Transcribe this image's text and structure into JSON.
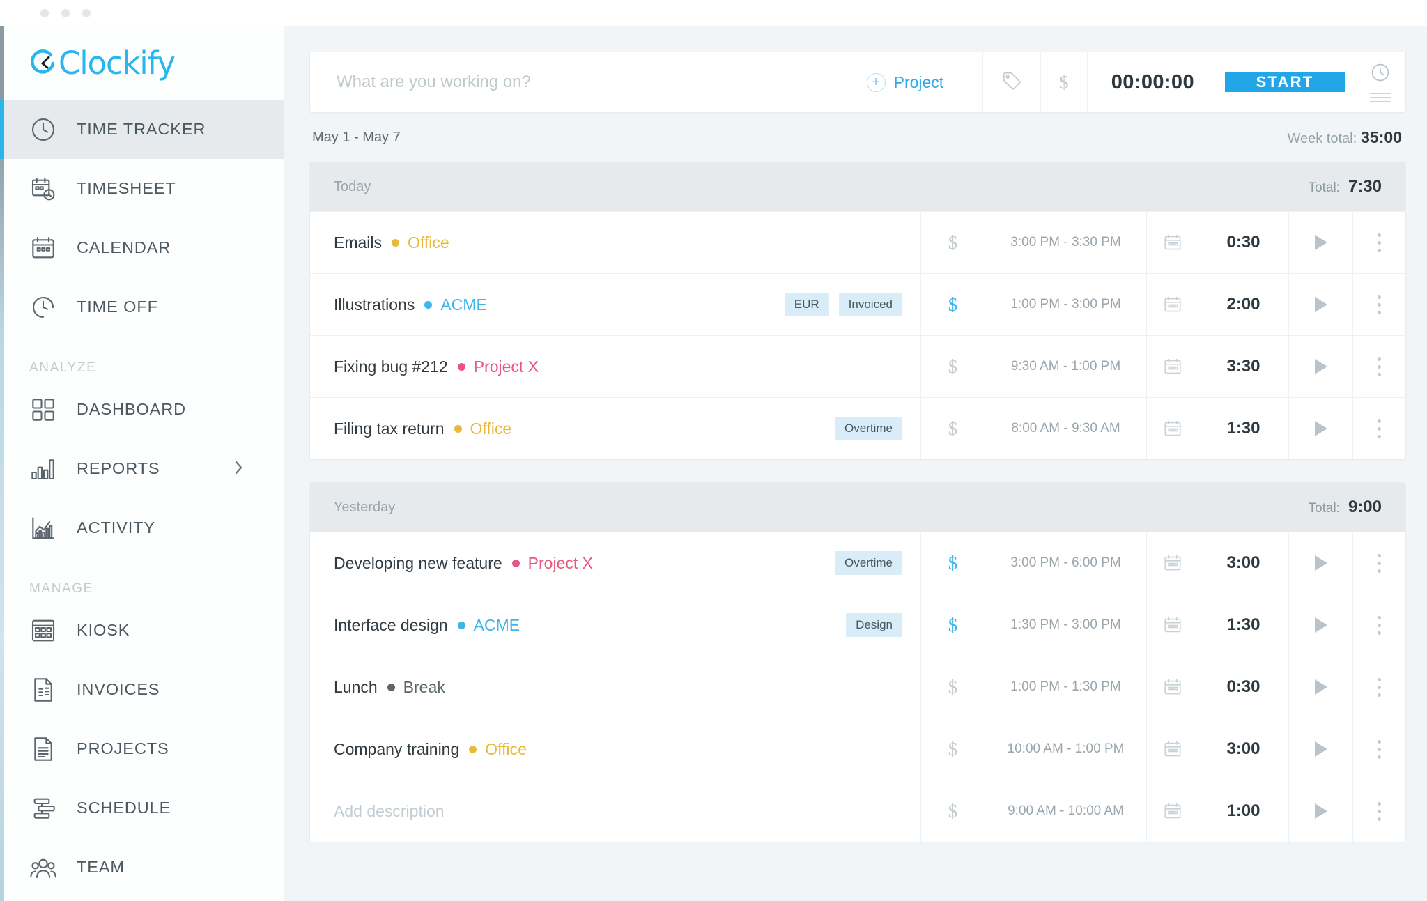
{
  "window": {
    "dots": 3
  },
  "brand": {
    "name": "Clockify",
    "color": "#28b6ef"
  },
  "sidebar": {
    "items": [
      {
        "label": "TIME TRACKER",
        "icon": "clock-icon",
        "active": true,
        "section": null,
        "chevron": false
      },
      {
        "label": "TIMESHEET",
        "icon": "timesheet-icon",
        "active": false,
        "section": null,
        "chevron": false
      },
      {
        "label": "CALENDAR",
        "icon": "calendar-icon",
        "active": false,
        "section": null,
        "chevron": false
      },
      {
        "label": "TIME OFF",
        "icon": "time-off-icon",
        "active": false,
        "section": null,
        "chevron": false
      },
      {
        "label": "DASHBOARD",
        "icon": "dashboard-icon",
        "active": false,
        "section": "ANALYZE",
        "chevron": false
      },
      {
        "label": "REPORTS",
        "icon": "reports-icon",
        "active": false,
        "section": null,
        "chevron": true
      },
      {
        "label": "ACTIVITY",
        "icon": "activity-icon",
        "active": false,
        "section": null,
        "chevron": false
      },
      {
        "label": "KIOSK",
        "icon": "kiosk-icon",
        "active": false,
        "section": "MANAGE",
        "chevron": false
      },
      {
        "label": "INVOICES",
        "icon": "invoices-icon",
        "active": false,
        "section": null,
        "chevron": false
      },
      {
        "label": "PROJECTS",
        "icon": "projects-icon",
        "active": false,
        "section": null,
        "chevron": false
      },
      {
        "label": "SCHEDULE",
        "icon": "schedule-icon",
        "active": false,
        "section": null,
        "chevron": false
      },
      {
        "label": "TEAM",
        "icon": "team-icon",
        "active": false,
        "section": null,
        "chevron": false
      }
    ],
    "sections": [
      "ANALYZE",
      "MANAGE"
    ]
  },
  "timer": {
    "placeholder": "What are you working on?",
    "value": "",
    "project_label": "Project",
    "tag_icon": "tag-icon",
    "billable_icon": "dollar-icon",
    "duration": "00:00:00",
    "start_label": "START",
    "mode_icon": "clock-mode-icon",
    "list_icon": "list-mode-icon",
    "accent": "#21a7e8"
  },
  "week": {
    "range": "May 1 - May 7",
    "total_label": "Week total:",
    "total_value": "35:00"
  },
  "days": [
    {
      "name": "Today",
      "total_label": "Total:",
      "total_value": "7:30",
      "entries": [
        {
          "description": "Emails",
          "is_placeholder": false,
          "project": "Office",
          "project_color": "#e9b93c",
          "tags": [],
          "billable": false,
          "range": "3:00 PM - 3:30 PM",
          "duration": "0:30"
        },
        {
          "description": "Illustrations",
          "is_placeholder": false,
          "project": "ACME",
          "project_color": "#3fb5ea",
          "tags": [
            "EUR",
            "Invoiced"
          ],
          "billable": true,
          "range": "1:00 PM - 3:00 PM",
          "duration": "2:00"
        },
        {
          "description": "Fixing bug #212",
          "is_placeholder": false,
          "project": "Project X",
          "project_color": "#e8577f",
          "tags": [],
          "billable": false,
          "range": "9:30 AM - 1:00 PM",
          "duration": "3:30"
        },
        {
          "description": "Filing tax return",
          "is_placeholder": false,
          "project": "Office",
          "project_color": "#e9b93c",
          "tags": [
            "Overtime"
          ],
          "billable": false,
          "range": "8:00 AM - 9:30 AM",
          "duration": "1:30"
        }
      ]
    },
    {
      "name": "Yesterday",
      "total_label": "Total:",
      "total_value": "9:00",
      "entries": [
        {
          "description": "Developing new feature",
          "is_placeholder": false,
          "project": "Project X",
          "project_color": "#e8577f",
          "tags": [
            "Overtime"
          ],
          "billable": true,
          "range": "3:00 PM - 6:00 PM",
          "duration": "3:00"
        },
        {
          "description": "Interface design",
          "is_placeholder": false,
          "project": "ACME",
          "project_color": "#3fb5ea",
          "tags": [
            "Design"
          ],
          "billable": true,
          "range": "1:30 PM - 3:00 PM",
          "duration": "1:30"
        },
        {
          "description": "Lunch",
          "is_placeholder": false,
          "project": "Break",
          "project_color": "#5a656c",
          "tags": [],
          "billable": false,
          "range": "1:00 PM - 1:30 PM",
          "duration": "0:30"
        },
        {
          "description": "Company training",
          "is_placeholder": false,
          "project": "Office",
          "project_color": "#e9b93c",
          "tags": [],
          "billable": false,
          "range": "10:00 AM - 1:00 PM",
          "duration": "3:00"
        },
        {
          "description": "Add description",
          "is_placeholder": true,
          "project": "",
          "project_color": "",
          "tags": [],
          "billable": false,
          "range": "9:00 AM - 10:00 AM",
          "duration": "1:00"
        }
      ]
    }
  ]
}
